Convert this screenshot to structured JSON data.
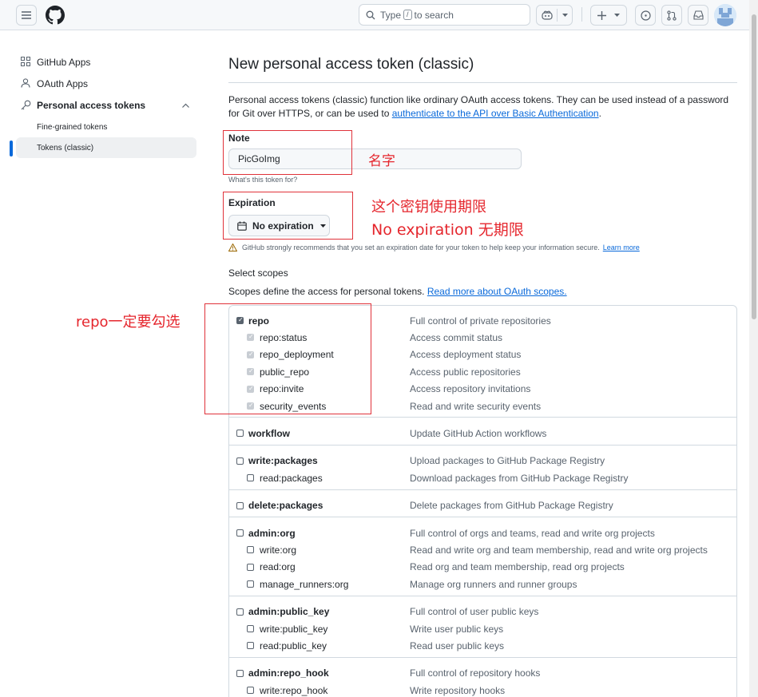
{
  "header": {
    "search_text_before": "Type",
    "search_key": "/",
    "search_text_after": "to search"
  },
  "sidebar": {
    "items": [
      {
        "label": "GitHub Apps"
      },
      {
        "label": "OAuth Apps"
      },
      {
        "label": "Personal access tokens"
      }
    ],
    "sub_items": [
      {
        "label": "Fine-grained tokens"
      },
      {
        "label": "Tokens (classic)"
      }
    ]
  },
  "main": {
    "title": "New personal access token (classic)",
    "desc_text": "Personal access tokens (classic) function like ordinary OAuth access tokens. They can be used instead of a password for Git over HTTPS, or can be used to ",
    "desc_link": "authenticate to the API over Basic Authentication",
    "desc_end": ".",
    "note_label": "Note",
    "note_value": "PicGoImg",
    "note_hint": "What's this token for?",
    "expiration_label": "Expiration",
    "expiration_value": "No expiration",
    "expiration_warning": "GitHub strongly recommends that you set an expiration date for your token to help keep your information secure.",
    "expiration_learn_more": "Learn more",
    "scopes_title": "Select scopes",
    "scopes_desc": "Scopes define the access for personal tokens.",
    "scopes_link": "Read more about OAuth scopes."
  },
  "annotations": {
    "name_note": "名字",
    "expiration_note_1": "这个密钥使用期限",
    "expiration_note_2": "No expiration 无期限",
    "repo_note": "repo一定要勾选"
  },
  "scopes": [
    {
      "name": "repo",
      "desc": "Full control of private repositories",
      "level": "top",
      "checked": true
    },
    {
      "name": "repo:status",
      "desc": "Access commit status",
      "level": "sub",
      "checked": true
    },
    {
      "name": "repo_deployment",
      "desc": "Access deployment status",
      "level": "sub",
      "checked": true
    },
    {
      "name": "public_repo",
      "desc": "Access public repositories",
      "level": "sub",
      "checked": true
    },
    {
      "name": "repo:invite",
      "desc": "Access repository invitations",
      "level": "sub",
      "checked": true
    },
    {
      "name": "security_events",
      "desc": "Read and write security events",
      "level": "sub",
      "checked": true
    },
    {
      "name": "workflow",
      "desc": "Update GitHub Action workflows",
      "level": "top",
      "checked": false
    },
    {
      "name": "write:packages",
      "desc": "Upload packages to GitHub Package Registry",
      "level": "top",
      "checked": false
    },
    {
      "name": "read:packages",
      "desc": "Download packages from GitHub Package Registry",
      "level": "sub",
      "checked": false
    },
    {
      "name": "delete:packages",
      "desc": "Delete packages from GitHub Package Registry",
      "level": "top",
      "checked": false
    },
    {
      "name": "admin:org",
      "desc": "Full control of orgs and teams, read and write org projects",
      "level": "top",
      "checked": false
    },
    {
      "name": "write:org",
      "desc": "Read and write org and team membership, read and write org projects",
      "level": "sub",
      "checked": false
    },
    {
      "name": "read:org",
      "desc": "Read org and team membership, read org projects",
      "level": "sub",
      "checked": false
    },
    {
      "name": "manage_runners:org",
      "desc": "Manage org runners and runner groups",
      "level": "sub",
      "checked": false
    },
    {
      "name": "admin:public_key",
      "desc": "Full control of user public keys",
      "level": "top",
      "checked": false
    },
    {
      "name": "write:public_key",
      "desc": "Write user public keys",
      "level": "sub",
      "checked": false
    },
    {
      "name": "read:public_key",
      "desc": "Read user public keys",
      "level": "sub",
      "checked": false
    },
    {
      "name": "admin:repo_hook",
      "desc": "Full control of repository hooks",
      "level": "top",
      "checked": false
    },
    {
      "name": "write:repo_hook",
      "desc": "Write repository hooks",
      "level": "sub",
      "checked": false
    }
  ]
}
